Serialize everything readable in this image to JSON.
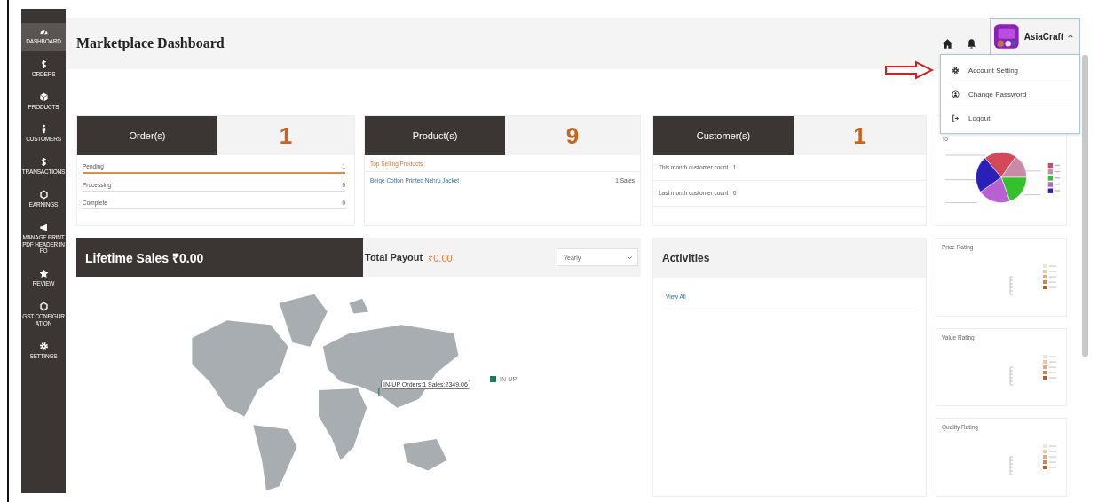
{
  "sidebar": {
    "items": [
      {
        "label": "DASHBOARD",
        "selected": true
      },
      {
        "label": "ORDERS",
        "selected": false
      },
      {
        "label": "PRODUCTS",
        "selected": false
      },
      {
        "label": "CUSTOMERS",
        "selected": false
      },
      {
        "label": "TRANSACTIONS",
        "selected": false
      },
      {
        "label": "EARNINGS",
        "selected": false
      },
      {
        "label": "MANAGE PRINT PDF HEADER INFO",
        "selected": false
      },
      {
        "label": "REVIEW",
        "selected": false
      },
      {
        "label": "GST CONFIGURATION",
        "selected": false
      },
      {
        "label": "SETTINGS",
        "selected": false
      }
    ]
  },
  "header": {
    "title": "Marketplace Dashboard",
    "user": {
      "name": "AsiaCraft",
      "menu_expanded": true
    }
  },
  "user_menu": [
    {
      "label": "Account Setting"
    },
    {
      "label": "Change Password"
    },
    {
      "label": "Logout"
    }
  ],
  "summary_cards": [
    {
      "kind": "orders",
      "title": "Order(s)",
      "count": "1",
      "rows": [
        {
          "label": "Pending",
          "value": "1",
          "selected": true
        },
        {
          "label": "Processing",
          "value": "0",
          "selected": false
        },
        {
          "label": "Complete",
          "value": "0",
          "selected": false
        }
      ]
    },
    {
      "kind": "products",
      "title": "Product(s)",
      "count": "9",
      "subtitle": "Top Selling Products",
      "rows": [
        {
          "label": "Beige Cotton Printed Nehru Jacket",
          "value": "1 Sales"
        }
      ]
    },
    {
      "kind": "customers",
      "title": "Customer(s)",
      "count": "1",
      "rows": [
        {
          "label": "This month customer count : 1"
        },
        {
          "label": "Last month customer count : 0"
        }
      ]
    }
  ],
  "top_products": {
    "title": "To"
  },
  "sales": {
    "lifetime": "Lifetime Sales ₹0.00",
    "payout_label": "Total Payout",
    "payout_value": "₹0.00",
    "period": "Yearly",
    "map_tooltip": "IN-UP Orders:1 Sales:2349.06",
    "legend": [
      {
        "label": "IN-UP",
        "color": "#1f7a5c"
      }
    ]
  },
  "activities": {
    "title": "Activities",
    "link": "View All"
  },
  "ratings": [
    {
      "title": "Price Rating"
    },
    {
      "title": "Value Rating"
    },
    {
      "title": "Quality Rating"
    }
  ]
}
